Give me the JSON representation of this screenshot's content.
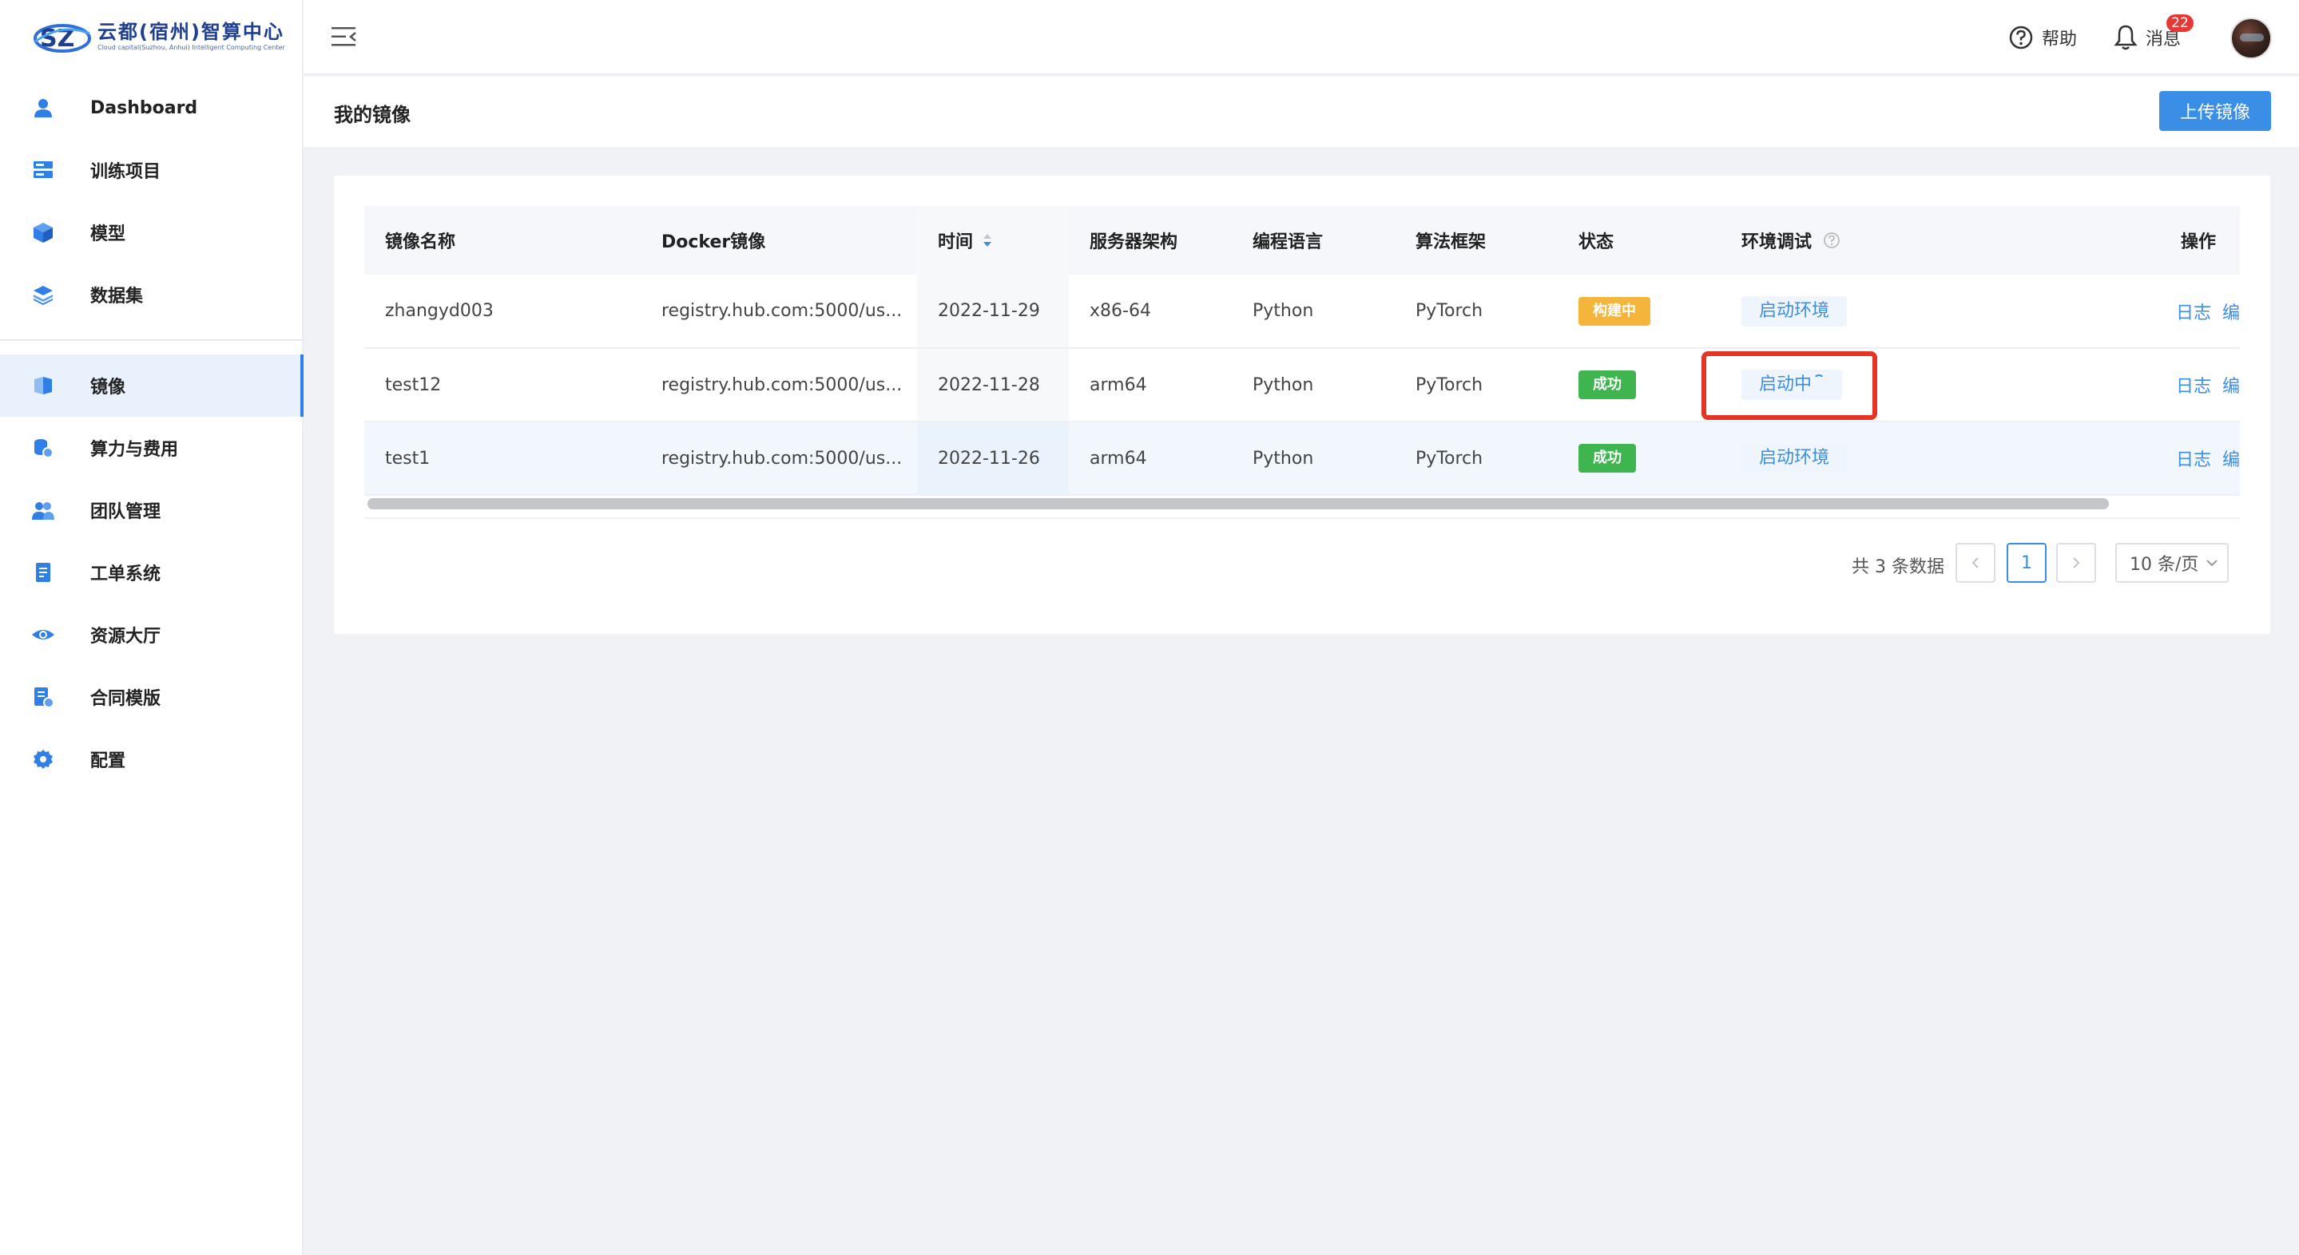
{
  "brand": {
    "title": "云都(宿州)智算中心",
    "subtitle": "Cloud capital(Suzhou, Anhui) Intelligent Computing Center"
  },
  "sidebar": {
    "items": [
      {
        "label": "Dashboard",
        "icon": "user-icon"
      },
      {
        "label": "训练项目",
        "icon": "server-icon"
      },
      {
        "label": "模型",
        "icon": "cube-icon"
      },
      {
        "label": "数据集",
        "icon": "layers-icon"
      },
      {
        "label": "镜像",
        "icon": "image-icon",
        "active": true
      },
      {
        "label": "算力与费用",
        "icon": "compute-cost-icon"
      },
      {
        "label": "团队管理",
        "icon": "team-icon"
      },
      {
        "label": "工单系统",
        "icon": "ticket-icon"
      },
      {
        "label": "资源大厅",
        "icon": "eye-icon"
      },
      {
        "label": "合同模版",
        "icon": "contract-icon"
      },
      {
        "label": "配置",
        "icon": "gear-icon"
      }
    ]
  },
  "topbar": {
    "help_label": "帮助",
    "messages_label": "消息",
    "messages_count": "22"
  },
  "page": {
    "title": "我的镜像",
    "upload_label": "上传镜像"
  },
  "table": {
    "columns": [
      "镜像名称",
      "Docker镜像",
      "时间",
      "服务器架构",
      "编程语言",
      "算法框架",
      "状态",
      "环境调试",
      "操作"
    ],
    "rows": [
      {
        "name": "zhangyd003",
        "docker": "registry.hub.com:5000/us...",
        "time": "2022-11-29",
        "arch": "x86-64",
        "lang": "Python",
        "framework": "PyTorch",
        "status": "构建中",
        "status_type": "building",
        "env": "启动环境",
        "op_log": "日志",
        "op_edit": "编"
      },
      {
        "name": "test12",
        "docker": "registry.hub.com:5000/us...",
        "time": "2022-11-28",
        "arch": "arm64",
        "lang": "Python",
        "framework": "PyTorch",
        "status": "成功",
        "status_type": "success",
        "env": "启动中",
        "op_log": "日志",
        "op_edit": "编"
      },
      {
        "name": "test1",
        "docker": "registry.hub.com:5000/us...",
        "time": "2022-11-26",
        "arch": "arm64",
        "lang": "Python",
        "framework": "PyTorch",
        "status": "成功",
        "status_type": "success",
        "env": "启动环境",
        "op_log": "日志",
        "op_edit": "编"
      }
    ]
  },
  "pagination": {
    "total": "共 3 条数据",
    "current_page": "1",
    "page_size": "10 条/页"
  },
  "colors": {
    "accent": "#3a8ee6",
    "building": "#f4b53d",
    "success": "#3fb550",
    "highlight": "#e53324"
  }
}
